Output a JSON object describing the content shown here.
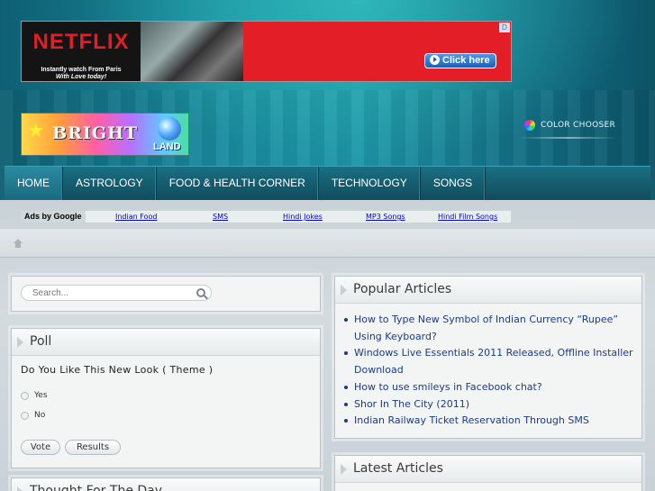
{
  "ad": {
    "brand": "NETFLIX",
    "line1": "Instantly watch From Paris",
    "line2": "With Love today!",
    "cta": "Click here",
    "choice": "D"
  },
  "logo": {
    "word1": "BRIGHT",
    "word2": "LAND"
  },
  "color_chooser": {
    "label": "COLOR CHOOSER"
  },
  "nav": {
    "items": [
      {
        "label": "HOME"
      },
      {
        "label": "ASTROLOGY"
      },
      {
        "label": "FOOD & HEALTH CORNER"
      },
      {
        "label": "TECHNOLOGY"
      },
      {
        "label": "SONGS"
      }
    ]
  },
  "links_bar": {
    "ads_by": "Ads by Google",
    "links": [
      "Indian Food",
      "SMS",
      "Hindi Jokes",
      "MP3 Songs",
      "Hindi Film Songs"
    ]
  },
  "search": {
    "placeholder": "Search..."
  },
  "poll": {
    "title": "Poll",
    "question": "Do You Like This New Look ( Theme )",
    "options": [
      "Yes",
      "No"
    ],
    "vote": "Vote",
    "results": "Results"
  },
  "popular": {
    "title": "Popular Articles",
    "articles": [
      "How to Type New Symbol of Indian Currency “Rupee” Using Keyboard?",
      "Windows Live Essentials 2011 Released, Offline Installer Download",
      "How to use smileys in Facebook chat?",
      "Shor In The City (2011)",
      "Indian Railway Ticket Reservation Through SMS"
    ]
  },
  "latest": {
    "title": "Latest Articles"
  },
  "bottom_left": {
    "title": "Thought For The Day"
  },
  "colors": {
    "nav_bg": "#114c5c",
    "accent_teal": "#1a8da0",
    "link_blue": "#1a3a8a",
    "ad_red": "#e41e26"
  }
}
